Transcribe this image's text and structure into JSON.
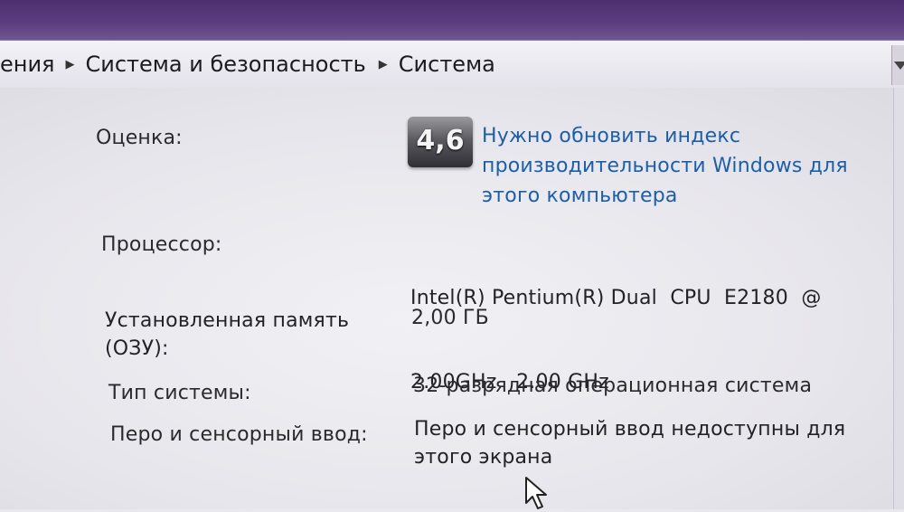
{
  "breadcrumb": {
    "items": [
      "ения",
      "Система и безопасность",
      "Система"
    ]
  },
  "rating": {
    "label": "Оценка:",
    "score": "4,6",
    "link_text": "Нужно обновить индекс производительности Windows для этого компьютера",
    "link_lines": [
      "Нужно обновить индекс",
      "производительности Windows для",
      "этого компьютера"
    ]
  },
  "processor": {
    "label": "Процессор:",
    "value_lines": [
      "Intel(R) Pentium(R) Dual  CPU  E2180  @",
      "2.00GHz   2.00 GHz"
    ]
  },
  "memory": {
    "label_lines": [
      "Установленная память",
      "(ОЗУ):"
    ],
    "value": "2,00 ГБ"
  },
  "system_type": {
    "label": "Тип системы:",
    "value": "32-разрядная операционная система"
  },
  "pen_touch": {
    "label": "Перо и сенсорный ввод:",
    "value_lines": [
      "Перо и сенсорный ввод недоступны для",
      "этого экрана"
    ]
  },
  "icons": {
    "separator": "triangle-right-icon",
    "dropdown": "chevron-down-icon",
    "cursor": "mouse-pointer-icon"
  },
  "colors": {
    "link": "#1c5fa8",
    "title_strip": "#5b3c7e",
    "badge": "#4a4a50"
  }
}
